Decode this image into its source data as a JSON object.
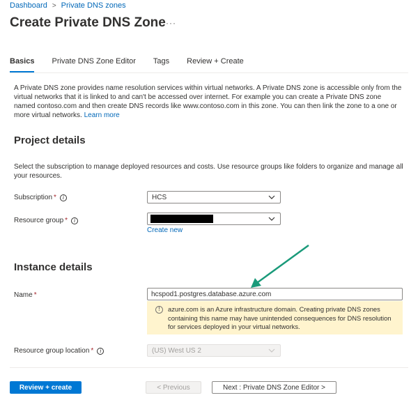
{
  "breadcrumb": {
    "items": [
      "Dashboard",
      "Private DNS zones"
    ]
  },
  "page": {
    "title": "Create Private DNS Zone",
    "more": "···"
  },
  "tabs": [
    {
      "label": "Basics",
      "active": true
    },
    {
      "label": "Private DNS Zone Editor",
      "active": false
    },
    {
      "label": "Tags",
      "active": false
    },
    {
      "label": "Review + Create",
      "active": false
    }
  ],
  "intro": {
    "text": "A Private DNS zone provides name resolution services within virtual networks. A Private DNS zone is accessible only from the virtual networks that it is linked to and can't be accessed over internet. For example you can create a Private DNS zone named contoso.com and then create DNS records like www.contoso.com in this zone. You can then link the zone to a one or more virtual networks.",
    "learn_more": "Learn more"
  },
  "project": {
    "title": "Project details",
    "description": "Select the subscription to manage deployed resources and costs. Use resource groups like folders to organize and manage all your resources.",
    "subscription_label": "Subscription",
    "subscription_value": "HCS",
    "resource_group_label": "Resource group",
    "create_new": "Create new",
    "required_mark": "*"
  },
  "instance": {
    "title": "Instance details",
    "name_label": "Name",
    "name_value": "hcspod1.postgres.database.azure.com",
    "warning_text": "azure.com is an Azure infrastructure domain. Creating private DNS zones containing this name may have unintended consequences for DNS resolution for services deployed in your virtual networks.",
    "location_label": "Resource group location",
    "location_value": "(US) West US 2"
  },
  "footer": {
    "review_create": "Review + create",
    "previous": "< Previous",
    "next": "Next : Private DNS Zone Editor >"
  },
  "colors": {
    "accent": "#0078d4",
    "link": "#0067b8",
    "warning_bg": "#fff4ce",
    "annotation_arrow": "#1a9a7a"
  }
}
